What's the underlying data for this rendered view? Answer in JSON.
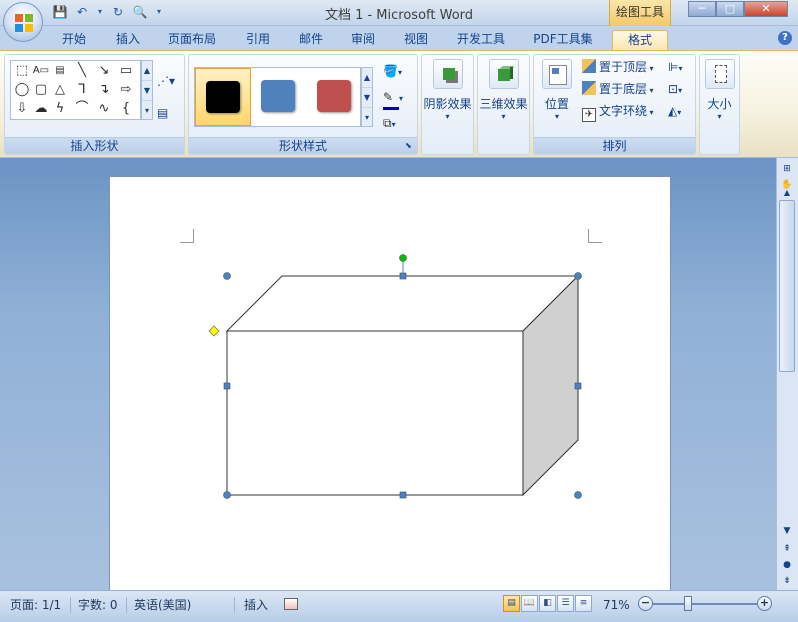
{
  "window": {
    "title": "文档 1 - Microsoft Word",
    "context_tool": "绘图工具",
    "min_label": "─",
    "max_label": "□",
    "close_label": "✕"
  },
  "tabs": [
    {
      "label": "开始"
    },
    {
      "label": "插入"
    },
    {
      "label": "页面布局"
    },
    {
      "label": "引用"
    },
    {
      "label": "邮件"
    },
    {
      "label": "审阅"
    },
    {
      "label": "视图"
    },
    {
      "label": "开发工具"
    },
    {
      "label": "PDF工具集"
    },
    {
      "label": "格式",
      "active": true
    }
  ],
  "ribbon": {
    "insert_shapes": {
      "label": "插入形状"
    },
    "shape_styles": {
      "label": "形状样式",
      "swatches": [
        "#000000",
        "#4f81bd",
        "#c0504d"
      ]
    },
    "shadow": {
      "label": "阴影效果"
    },
    "three_d": {
      "label": "三维效果"
    },
    "arrange": {
      "label": "排列",
      "position": "位置",
      "bring_front": "置于顶层",
      "send_back": "置于底层",
      "text_wrap": "文字环绕"
    },
    "size": {
      "label": "大小"
    }
  },
  "document": {
    "shape": "3D box (cube) shape, selected"
  },
  "status": {
    "page": "页面: 1/1",
    "words": "字数: 0",
    "language": "英语(美国)",
    "mode": "插入",
    "zoom": "71%",
    "zoom_value": 71
  },
  "colors": {
    "accent": "#15428b",
    "selected_tab": "#fbe6b2",
    "cube_side": "#d0d0d0",
    "handle": "#4f81bd",
    "rotate_handle": "#00c000",
    "adjust_handle": "#ffff00"
  },
  "icons": [
    "office-button-icon",
    "save-icon",
    "undo-icon",
    "redo-icon",
    "print-preview-icon",
    "help-icon",
    "fill-color-icon",
    "line-color-icon",
    "shape-effect-icon"
  ]
}
